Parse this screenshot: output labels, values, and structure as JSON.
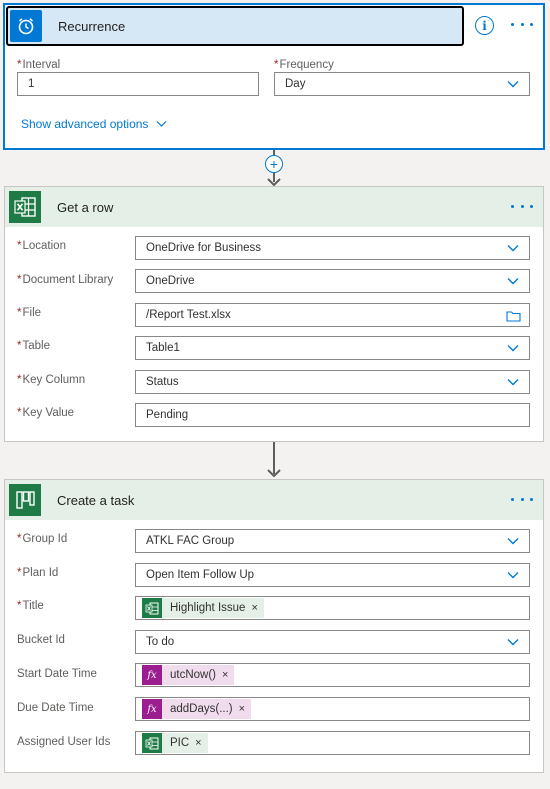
{
  "recurrence": {
    "title": "Recurrence",
    "more": "More options",
    "interval": {
      "label": "Interval",
      "value": "1"
    },
    "frequency": {
      "label": "Frequency",
      "value": "Day"
    },
    "advanced": "Show advanced options"
  },
  "connector": {
    "add": "+"
  },
  "get_row": {
    "title": "Get a row",
    "fields": [
      {
        "label": "Location",
        "required": "*",
        "value": "OneDrive for Business"
      },
      {
        "label": "Document Library",
        "required": "*",
        "value": "OneDrive"
      },
      {
        "label": "File",
        "required": "*",
        "value": "/Report Test.xlsx"
      },
      {
        "label": "Table",
        "required": "*",
        "value": "Table1"
      },
      {
        "label": "Key Column",
        "required": "*",
        "value": "Status"
      },
      {
        "label": "Key Value",
        "required": "*",
        "value": "Pending"
      }
    ]
  },
  "create_task": {
    "title": "Create a task",
    "fields": [
      {
        "label": "Group Id",
        "required": "*",
        "value": "ATKL FAC Group"
      },
      {
        "label": "Plan Id",
        "required": "*",
        "value": "Open Item Follow Up"
      },
      {
        "label": "Title",
        "required": "*",
        "token": "Highlight Issue",
        "token_icon": "excel-icon"
      },
      {
        "label": "Bucket Id",
        "value": "To do"
      },
      {
        "label": "Start Date Time",
        "token": "utcNow()",
        "token_icon": "fx-icon"
      },
      {
        "label": "Due Date Time",
        "token": "addDays(...)",
        "token_icon": "fx-icon"
      },
      {
        "label": "Assigned User Ids",
        "token": "PIC",
        "token_icon": "excel-icon"
      }
    ]
  },
  "common": {
    "req": "*",
    "token_remove": "×",
    "fx_symbol": "fx"
  },
  "colors": {
    "accent": "#0078d4",
    "excel_green": "#1e7b45",
    "func_purple": "#9b1d8f",
    "required_red": "#a4262c"
  }
}
